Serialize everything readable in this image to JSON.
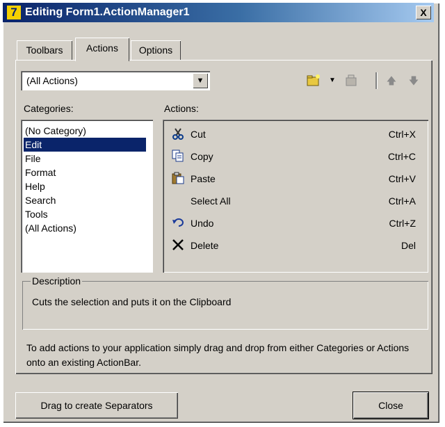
{
  "window": {
    "title": "Editing Form1.ActionManager1",
    "app_icon_glyph": "7",
    "close_glyph": "X"
  },
  "tabs": [
    {
      "label": "Toolbars",
      "active": false
    },
    {
      "label": "Actions",
      "active": true
    },
    {
      "label": "Options",
      "active": false
    }
  ],
  "actions_tab": {
    "category_filter": {
      "value": "(All Actions)"
    },
    "toolbar_icons": [
      "new-action-icon",
      "dropdown-arrow-icon",
      "delete-action-icon",
      "move-up-icon",
      "move-down-icon"
    ],
    "categories_label": "Categories:",
    "categories": [
      {
        "label": "(No Category)",
        "selected": false
      },
      {
        "label": "Edit",
        "selected": true
      },
      {
        "label": "File",
        "selected": false
      },
      {
        "label": "Format",
        "selected": false
      },
      {
        "label": "Help",
        "selected": false
      },
      {
        "label": "Search",
        "selected": false
      },
      {
        "label": "Tools",
        "selected": false
      },
      {
        "label": "(All Actions)",
        "selected": false
      }
    ],
    "actions_label": "Actions:",
    "actions": [
      {
        "label": "Cut",
        "shortcut": "Ctrl+X",
        "icon": "scissors-icon"
      },
      {
        "label": "Copy",
        "shortcut": "Ctrl+C",
        "icon": "copy-icon"
      },
      {
        "label": "Paste",
        "shortcut": "Ctrl+V",
        "icon": "paste-icon"
      },
      {
        "label": "Select All",
        "shortcut": "Ctrl+A",
        "icon": ""
      },
      {
        "label": "Undo",
        "shortcut": "Ctrl+Z",
        "icon": "undo-icon"
      },
      {
        "label": "Delete",
        "shortcut": "Del",
        "icon": "delete-x-icon"
      }
    ],
    "description_label": "Description",
    "description_text": "Cuts the selection and puts it on the Clipboard",
    "help_text": "To add actions to your application simply drag and drop from either Categories or Actions onto an existing ActionBar."
  },
  "buttons": {
    "separator": "Drag to create Separators",
    "close": "Close"
  },
  "colors": {
    "face": "#d4d0c8",
    "titlebar_start": "#0a246a",
    "selection": "#0a246a"
  }
}
